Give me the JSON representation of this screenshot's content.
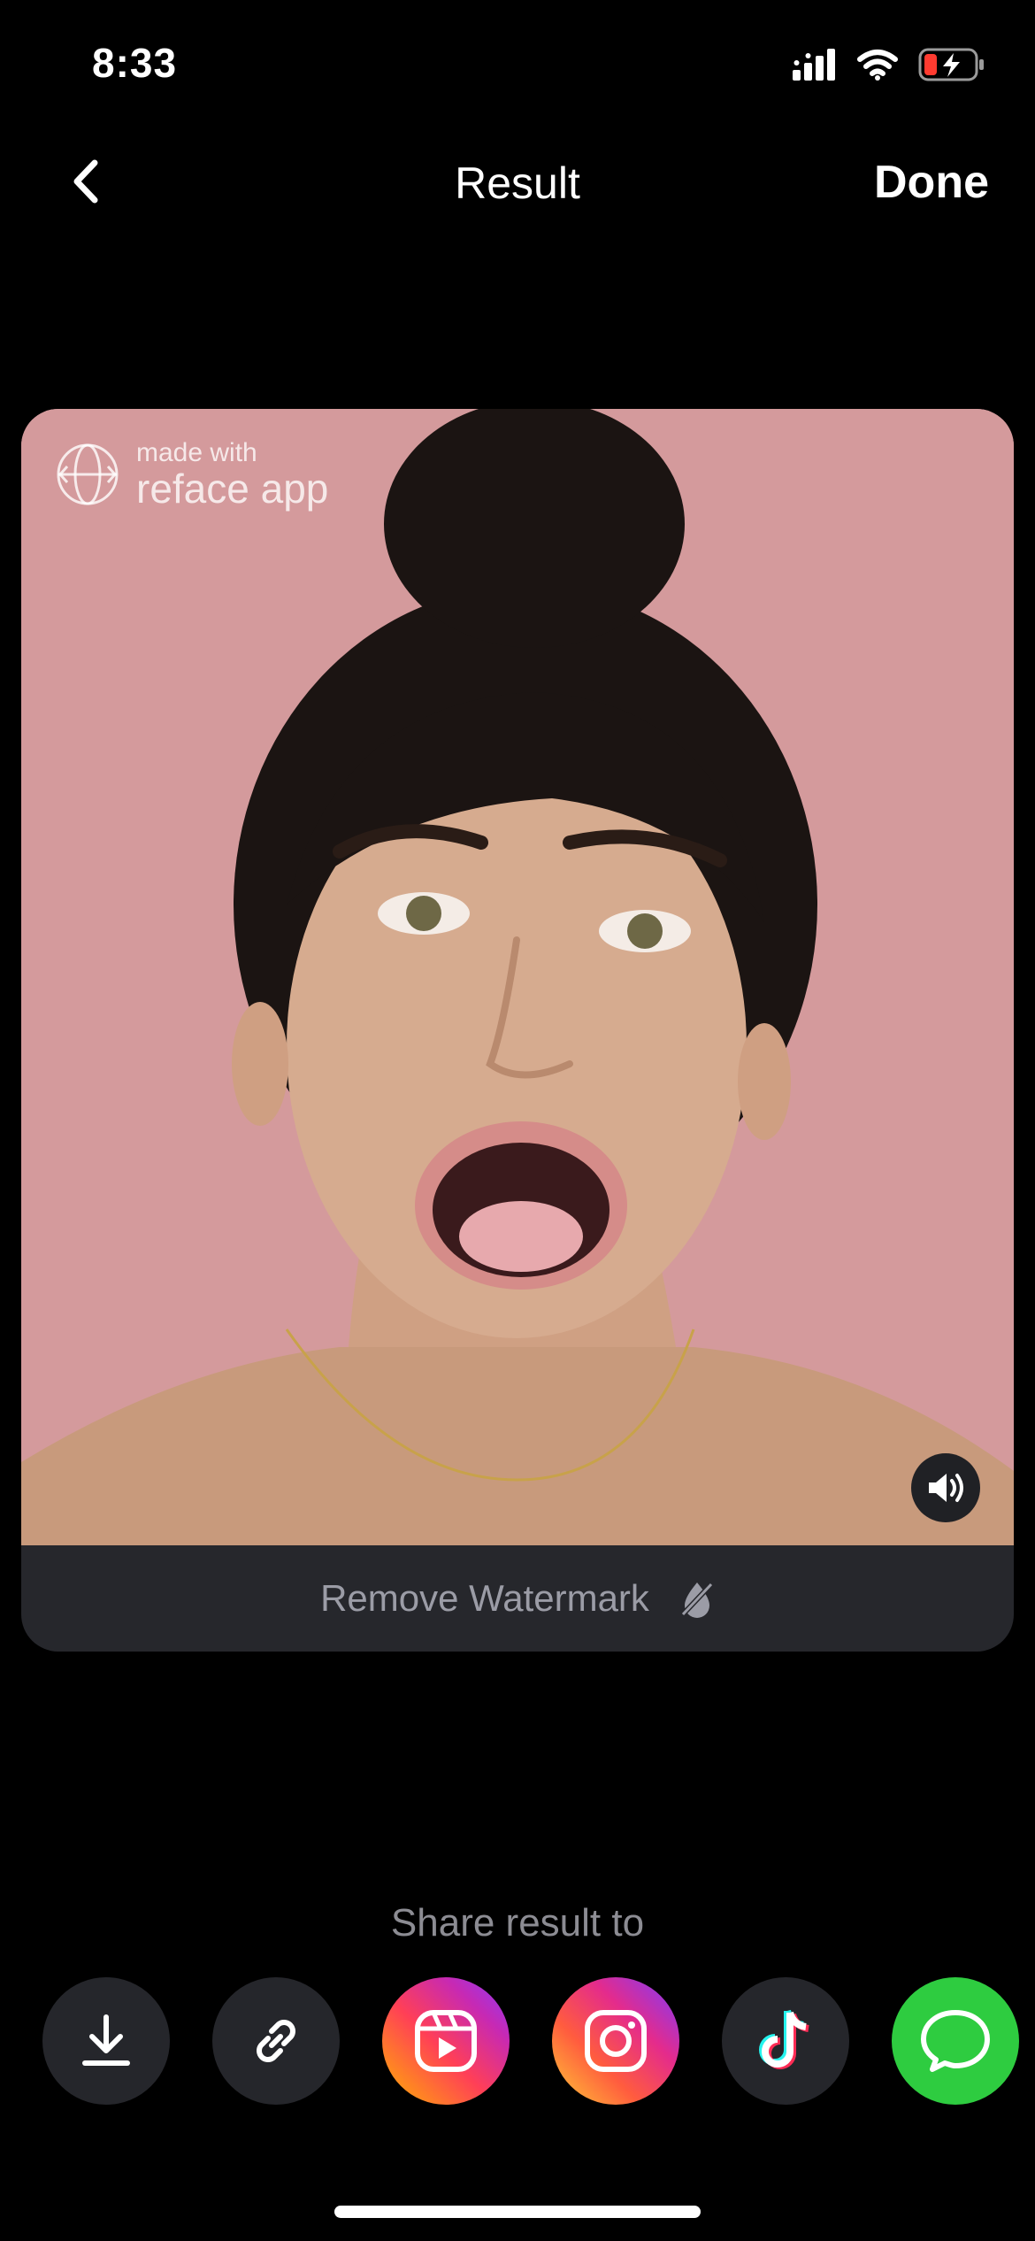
{
  "status_bar": {
    "time": "8:33"
  },
  "nav": {
    "title": "Result",
    "done_label": "Done"
  },
  "card": {
    "watermark_small": "made with",
    "watermark_big": "reface app",
    "remove_watermark_label": "Remove Watermark"
  },
  "share": {
    "label": "Share result to",
    "targets": [
      {
        "name": "download-icon"
      },
      {
        "name": "link-icon"
      },
      {
        "name": "instagram-reels-icon"
      },
      {
        "name": "instagram-icon"
      },
      {
        "name": "tiktok-icon"
      },
      {
        "name": "messages-icon"
      }
    ]
  },
  "colors": {
    "background": "#000000",
    "card_bar": "#26272c",
    "photo_bg": "#d49a9c",
    "messages_green": "#2ecc40"
  }
}
